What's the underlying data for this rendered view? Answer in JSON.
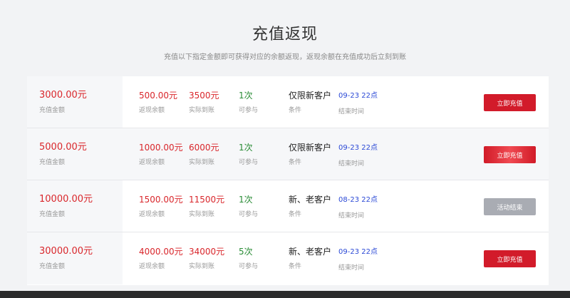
{
  "header": {
    "title": "充值返现",
    "subtitle": "充值以下指定金额即可获得对应的余额返现，返现余额在充值成功后立刻到账"
  },
  "labels": {
    "amount": "充值金额",
    "cashback": "返现余额",
    "actual": "实际到账",
    "times": "可参与",
    "condition": "条件",
    "end_time": "结束时间"
  },
  "rows": [
    {
      "amount": "3000.00元",
      "cashback": "500.00元",
      "actual": "3500元",
      "times": "1次",
      "condition": "仅限新客户",
      "end_time": "09-23 22点",
      "button": "立即充值",
      "status": "active"
    },
    {
      "amount": "5000.00元",
      "cashback": "1000.00元",
      "actual": "6000元",
      "times": "1次",
      "condition": "仅限新客户",
      "end_time": "09-23 22点",
      "button": "立即充值",
      "status": "active"
    },
    {
      "amount": "10000.00元",
      "cashback": "1500.00元",
      "actual": "11500元",
      "times": "1次",
      "condition": "新、老客户",
      "end_time": "08-23 22点",
      "button": "活动结束",
      "status": "ended"
    },
    {
      "amount": "30000.00元",
      "cashback": "4000.00元",
      "actual": "34000元",
      "times": "5次",
      "condition": "新、老客户",
      "end_time": "09-23 22点",
      "button": "立即充值",
      "status": "active"
    }
  ],
  "colors": {
    "accent_red": "#d21b2a",
    "times_green": "#2a8c36",
    "date_blue": "#2b49d6",
    "ended_gray": "#a9acb3"
  }
}
